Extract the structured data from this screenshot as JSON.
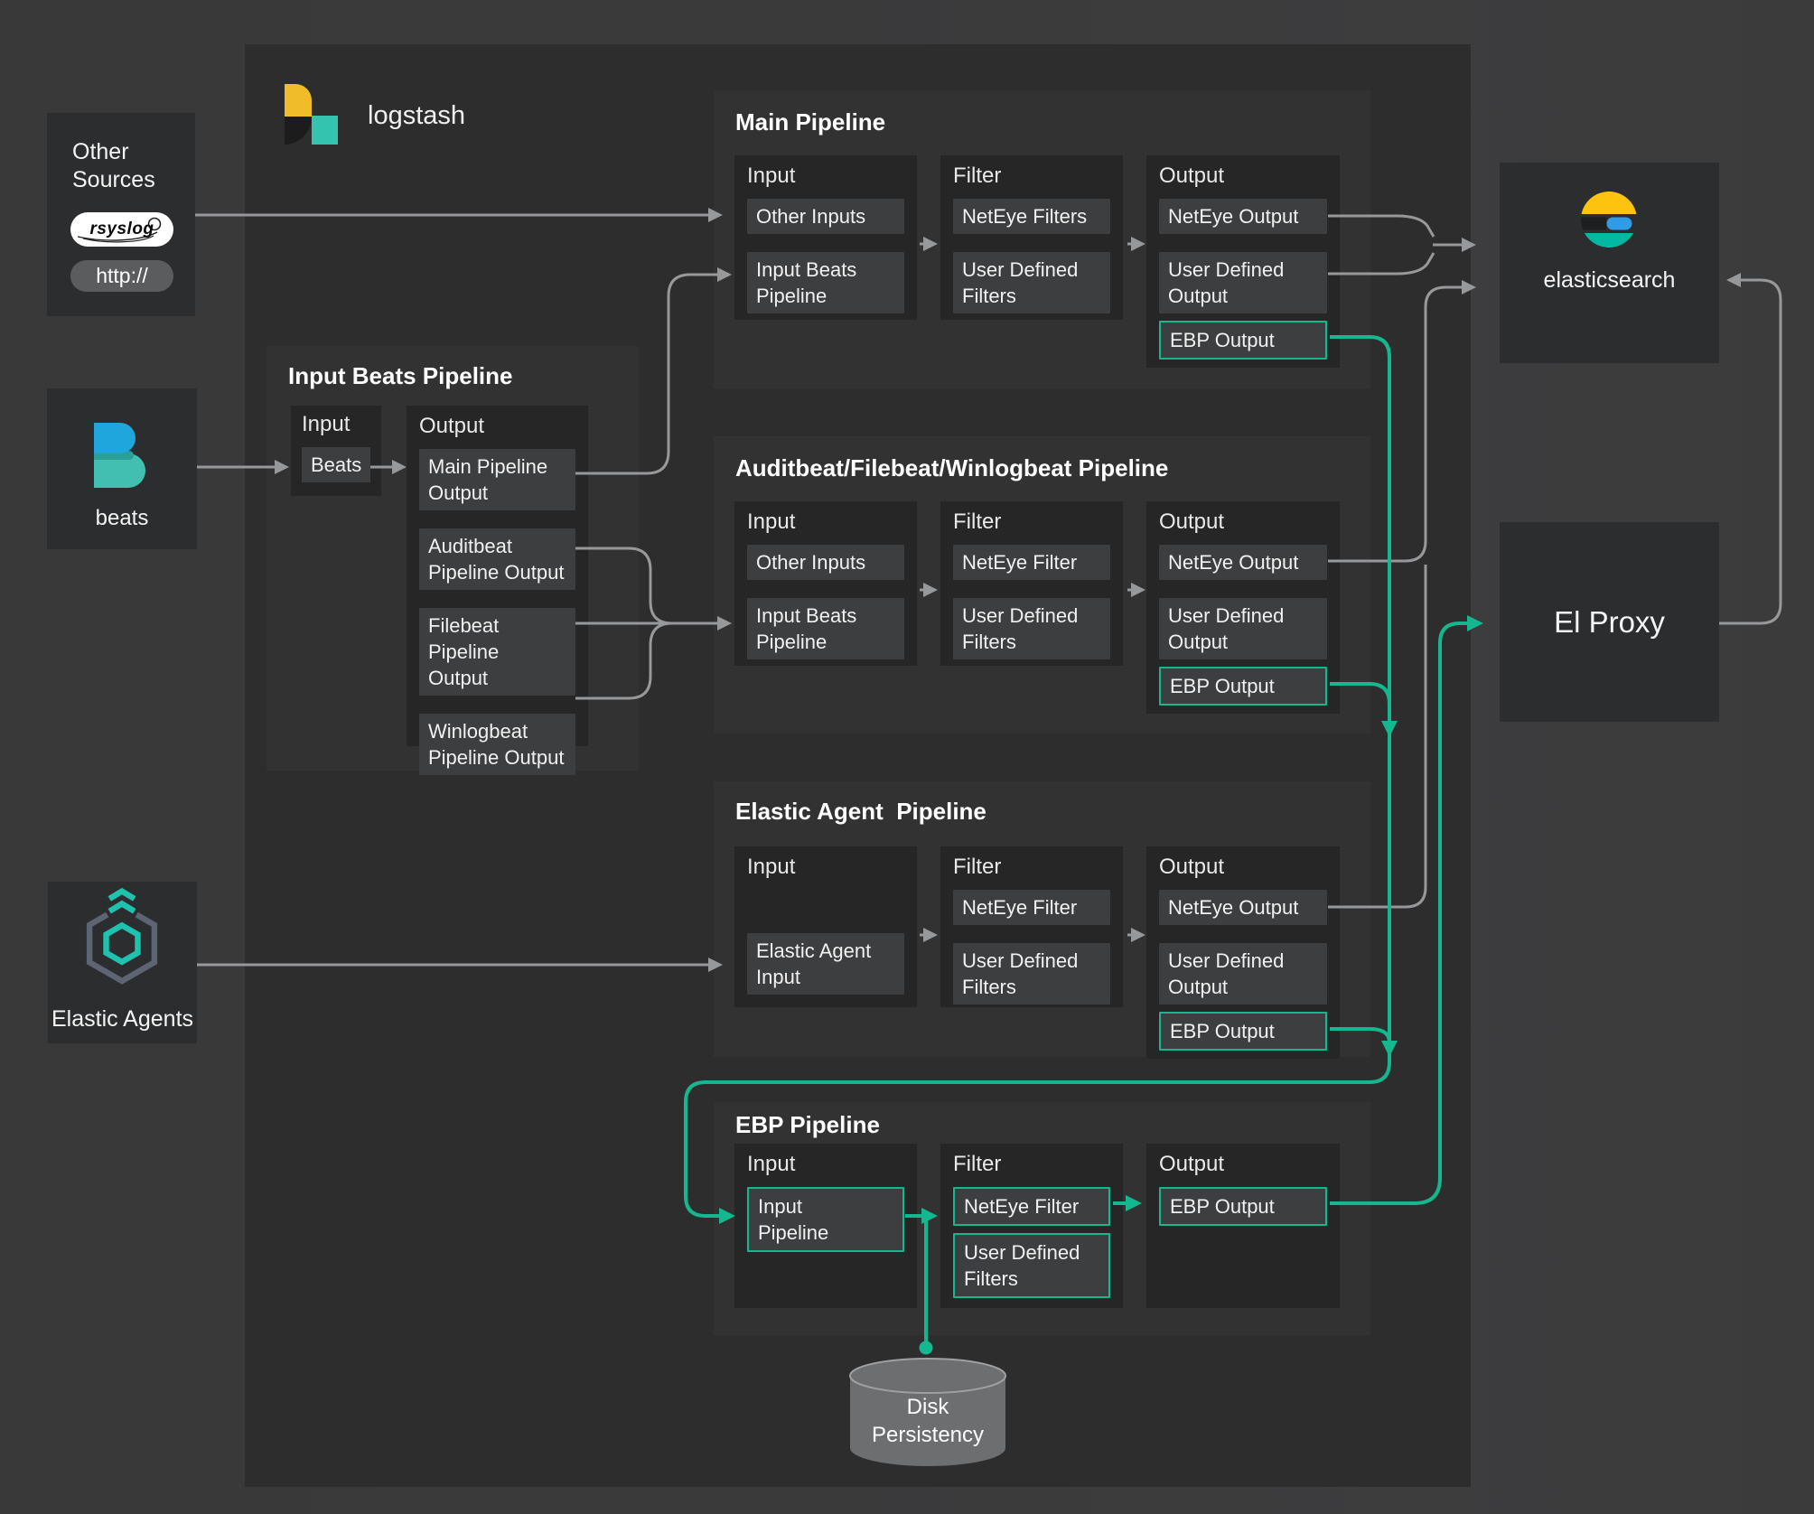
{
  "colors": {
    "teal_line": "#15b78e",
    "gray_line": "#96989a",
    "logstash_yellow": "#f0bc2a",
    "logstash_teal": "#35c3ae",
    "es_yellow": "#fdc30f",
    "es_blue": "#2f9ce8",
    "es_teal": "#02b8a2",
    "beats_blue": "#1ea6dd",
    "beats_teal": "#43bfb2"
  },
  "logstash": {
    "label": "logstash"
  },
  "sources": {
    "other_sources": {
      "label": "Other\nSources",
      "rsyslog_label": "rsyslog",
      "http_label": "http://"
    },
    "beats": {
      "label": "beats"
    },
    "elastic_agents": {
      "label": "Elastic Agents"
    }
  },
  "targets": {
    "elasticsearch": {
      "label": "elasticsearch"
    },
    "el_proxy": {
      "label": "El Proxy"
    }
  },
  "disk": {
    "label": "Disk\nPersistency"
  },
  "input_beats_pipeline": {
    "title": "Input Beats Pipeline",
    "input_label": "Input",
    "output_label": "Output",
    "input_items": [
      {
        "label": "Beats"
      }
    ],
    "output_items": [
      {
        "label": "Main Pipeline\nOutput"
      },
      {
        "label": "Auditbeat\nPipeline Output"
      },
      {
        "label": "Filebeat Pipeline\nOutput"
      },
      {
        "label": "Winlogbeat\nPipeline Output"
      }
    ]
  },
  "pipelines": [
    {
      "title": "Main Pipeline",
      "input_label": "Input",
      "filter_label": "Filter",
      "output_label": "Output",
      "input_items": [
        {
          "label": "Other Inputs"
        },
        {
          "label": "Input Beats\nPipeline"
        }
      ],
      "filter_items": [
        {
          "label": "NetEye Filters"
        },
        {
          "label": "User Defined\nFilters"
        }
      ],
      "output_items": [
        {
          "label": "NetEye Output"
        },
        {
          "label": "User Defined\nOutput"
        },
        {
          "label": "EBP Output",
          "teal": true
        }
      ]
    },
    {
      "title": "Auditbeat/Filebeat/Winlogbeat Pipeline",
      "input_label": "Input",
      "filter_label": "Filter",
      "output_label": "Output",
      "input_items": [
        {
          "label": "Other Inputs"
        },
        {
          "label": "Input Beats\nPipeline"
        }
      ],
      "filter_items": [
        {
          "label": "NetEye Filter"
        },
        {
          "label": "User Defined\nFilters"
        }
      ],
      "output_items": [
        {
          "label": "NetEye Output"
        },
        {
          "label": "User Defined\nOutput"
        },
        {
          "label": "EBP Output",
          "teal": true
        }
      ]
    },
    {
      "title": "Elastic Agent  Pipeline",
      "input_label": "Input",
      "filter_label": "Filter",
      "output_label": "Output",
      "input_items": [
        {
          "label": "Elastic Agent\nInput"
        }
      ],
      "filter_items": [
        {
          "label": "NetEye Filter"
        },
        {
          "label": "User Defined\nFilters"
        }
      ],
      "output_items": [
        {
          "label": "NetEye Output"
        },
        {
          "label": "User Defined\nOutput"
        },
        {
          "label": "EBP Output",
          "teal": true
        }
      ]
    },
    {
      "title": "EBP Pipeline",
      "input_label": "Input",
      "filter_label": "Filter",
      "output_label": "Output",
      "input_items": [
        {
          "label": "Input\nPipeline",
          "teal": true
        }
      ],
      "filter_items": [
        {
          "label": "NetEye Filter",
          "teal": true
        },
        {
          "label": "User Defined\nFilters",
          "teal": true
        }
      ],
      "output_items": [
        {
          "label": "EBP Output",
          "teal": true
        }
      ]
    }
  ]
}
